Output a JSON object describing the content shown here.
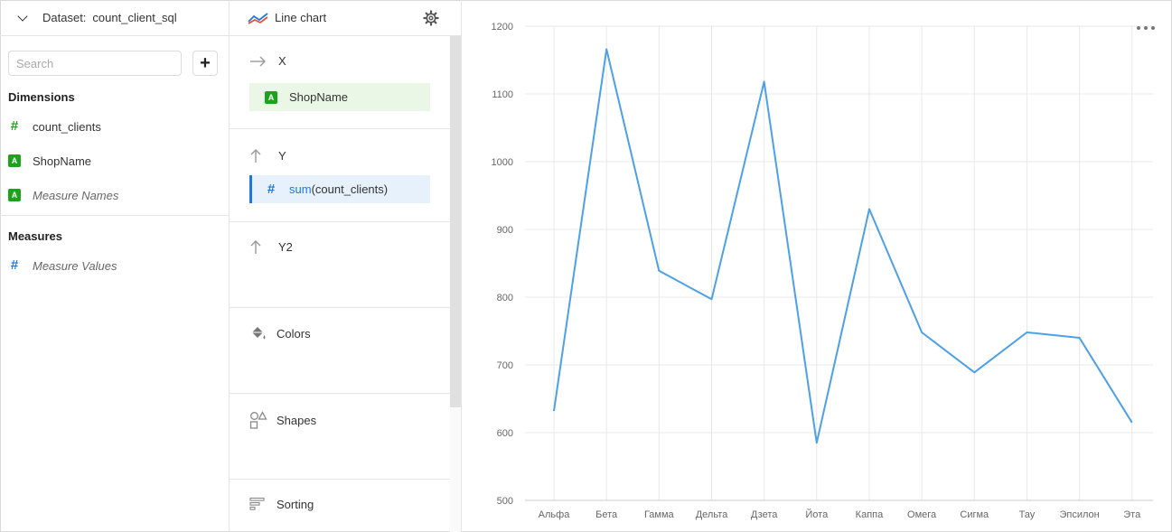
{
  "dataset": {
    "label": "Dataset:",
    "name": "count_client_sql",
    "search_placeholder": "Search",
    "add_label": "+",
    "dimensions_title": "Dimensions",
    "dimensions": [
      {
        "name": "count_clients",
        "type": "number"
      },
      {
        "name": "ShopName",
        "type": "string"
      },
      {
        "name": "Measure Names",
        "type": "string",
        "italic": true
      }
    ],
    "measures_title": "Measures",
    "measures": [
      {
        "name": "Measure Values",
        "type": "number",
        "italic": true
      }
    ]
  },
  "wizard": {
    "visualization": "Line chart",
    "slots": {
      "x": {
        "label": "X",
        "field": "ShopName"
      },
      "y": {
        "label": "Y",
        "field_fn": "sum",
        "field_arg": "(count_clients)"
      },
      "y2": {
        "label": "Y2"
      },
      "colors": {
        "label": "Colors"
      },
      "shapes": {
        "label": "Shapes"
      },
      "sorting": {
        "label": "Sorting"
      }
    }
  },
  "chart_data": {
    "type": "line",
    "categories": [
      "Альфа",
      "Бета",
      "Гамма",
      "Дельта",
      "Дзета",
      "Йота",
      "Каппа",
      "Омега",
      "Сигма",
      "Тау",
      "Эпсилон",
      "Эта"
    ],
    "values": [
      632,
      1166,
      839,
      797,
      1118,
      585,
      930,
      748,
      689,
      748,
      740,
      615
    ],
    "yticks": [
      500,
      600,
      700,
      800,
      900,
      1000,
      1100,
      1200
    ],
    "ylim": [
      500,
      1200
    ],
    "line_color": "#4da0e6",
    "grid": true
  },
  "colors": {
    "accent": "#1f7ad7",
    "dimension": "#1ba31b"
  }
}
